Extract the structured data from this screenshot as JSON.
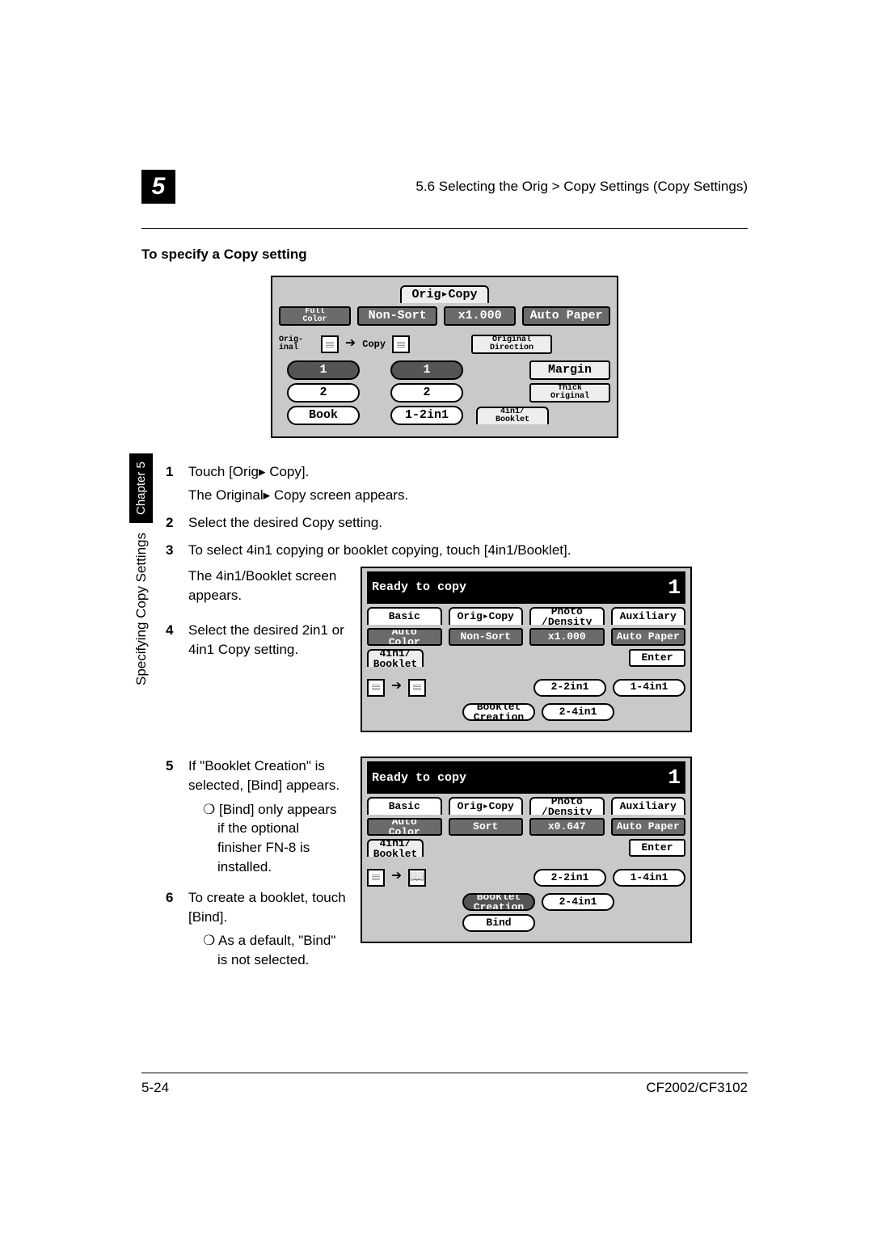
{
  "header": {
    "chapter_number": "5",
    "breadcrumb": "5.6 Selecting the Orig > Copy Settings (Copy Settings)"
  },
  "section_title": "To specify a Copy setting",
  "sidebar": {
    "label": "Specifying Copy Settings",
    "chapter": "Chapter 5"
  },
  "panel1": {
    "tab": "Orig▸Copy",
    "full_color": "Full\nColor",
    "non_sort": "Non-Sort",
    "zoom": "x1.000",
    "auto_paper": "Auto Paper",
    "orig_inal": "Orig-\ninal",
    "copy_label": "Copy",
    "orig_dir": "Original\nDirection",
    "one": "1",
    "margin": "Margin",
    "two": "2",
    "thick": "Thick\nOriginal",
    "book": "Book",
    "one_two": "1-2in1",
    "booklet": "4in1/\nBooklet"
  },
  "panel2": {
    "title": "Ready to copy",
    "count": "1",
    "tab_basic": "Basic",
    "tab_orig": "Orig▸Copy",
    "tab_photo": "Photo\n/Density",
    "tab_aux": "Auxiliary",
    "auto_color": "Auto\nColor",
    "sort_ns": "Non-Sort",
    "sort_s": "Sort",
    "zoom_a": "x1.000",
    "zoom_b": "x0.647",
    "auto_paper": "Auto Paper",
    "booklet_label": "4in1/\nBooklet",
    "enter": "Enter",
    "b2_2": "2-2in1",
    "b1_4": "1-4in1",
    "b_creation": "Booklet\nCreation",
    "b2_4": "2-4in1",
    "bind": "Bind"
  },
  "steps": {
    "s1": {
      "line1": "Touch [Orig",
      "line1b": "Copy].",
      "line2a": "The Original",
      "line2b": "Copy screen appears."
    },
    "s2": "Select the desired Copy setting.",
    "s3": {
      "line1": "To select 4in1 copying or booklet copying, touch [4in1/Booklet].",
      "line2": "The 4in1/Booklet screen appears."
    },
    "s4": "Select the desired 2in1 or 4in1 Copy setting.",
    "s5": {
      "line1": "If \"Booklet Creation\" is selected, [Bind] appears.",
      "bullet": "[Bind] only appears if the optional finisher FN-8 is installed."
    },
    "s6": {
      "line1": "To create a booklet, touch [Bind].",
      "bullet": "As a default, \"Bind\" is not selected."
    }
  },
  "footer": {
    "page": "5-24",
    "model": "CF2002/CF3102"
  }
}
